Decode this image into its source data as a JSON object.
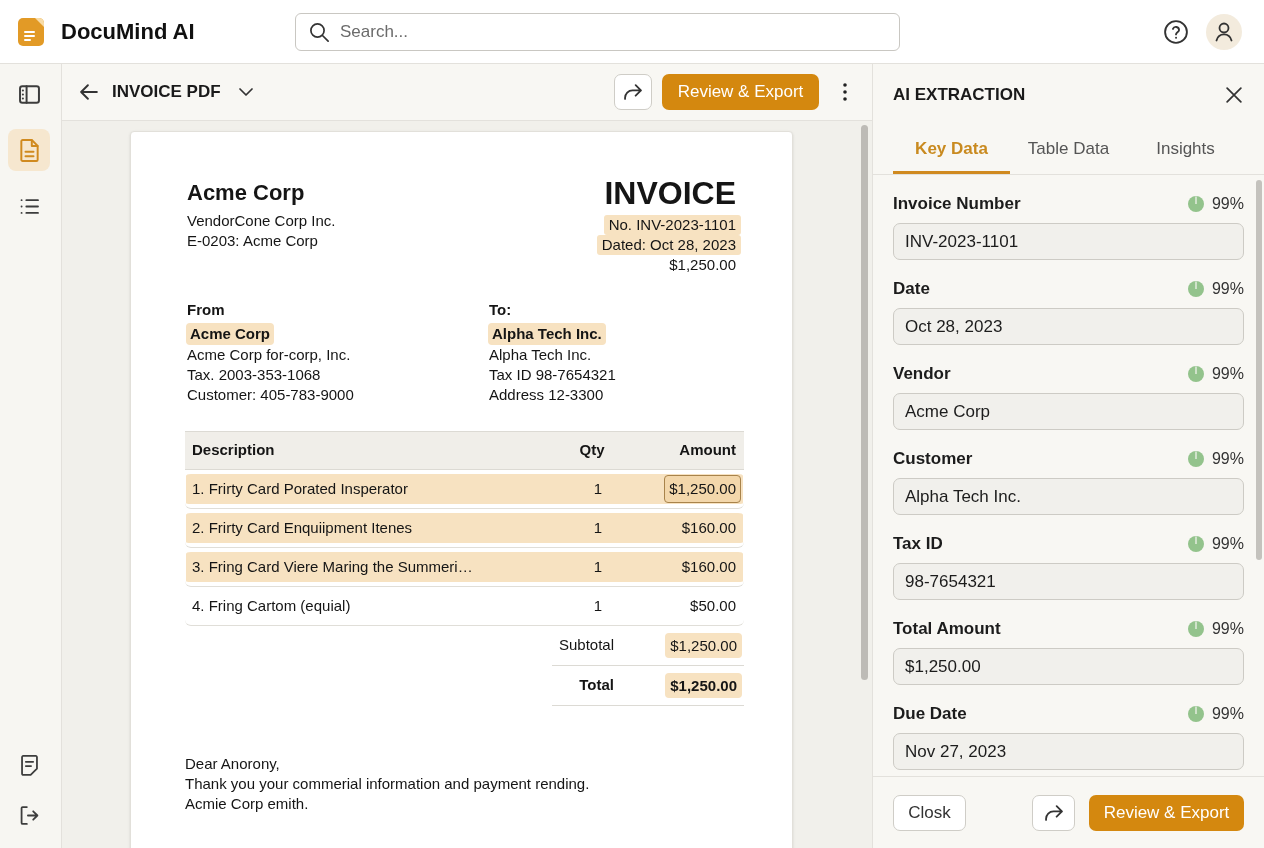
{
  "app": {
    "name": "DocuMind AI"
  },
  "search": {
    "placeholder": "Search..."
  },
  "rail": {
    "items": [
      {
        "kind": "panel",
        "selected": false
      },
      {
        "kind": "document",
        "selected": true
      },
      {
        "kind": "list",
        "selected": false
      }
    ]
  },
  "document_bar": {
    "title": "INVOICE PDF",
    "export_button": "Review & Export"
  },
  "invoice": {
    "vendor_name": "Acme Corp",
    "vendor_lines": [
      "VendorCone Corp Inc.",
      "E-0203: Acme Corp"
    ],
    "title": "INVOICE",
    "meta": [
      {
        "text": "No. INV-2023-1101",
        "highlighted": true
      },
      {
        "text": "Dated: Oct 28, 2023",
        "highlighted": true
      },
      {
        "text": "$1,250.00",
        "highlighted": false
      }
    ],
    "parties": [
      {
        "heading": "From",
        "name": "Acme Corp",
        "name_highlighted": true,
        "lines": [
          "Acme Corp for-corp, Inc.",
          "Tax. 2003-353-1068",
          "Customer: 405-783-9000"
        ]
      },
      {
        "heading": "To:",
        "name": "Alpha Tech Inc.",
        "name_highlighted": true,
        "lines": [
          "Alpha Tech Inc.",
          "Tax ID 98-7654321",
          "Address 12-3300"
        ]
      }
    ],
    "table": {
      "columns": [
        "Description",
        "Qty",
        "Amount"
      ],
      "rows": [
        {
          "description": "1. Frirty Card Porated Insperator",
          "qty": "1",
          "amount": "$1,250.00",
          "highlighted": true,
          "amount_selected": true
        },
        {
          "description": "2. Frirty Card Enquiipment Itenes",
          "qty": "1",
          "amount": "$160.00",
          "highlighted": true,
          "amount_selected": false
        },
        {
          "description": "3. Fring Card Viere Maring the Summeri…",
          "qty": "1",
          "amount": "$160.00",
          "highlighted": true,
          "amount_selected": false
        },
        {
          "description": "4. Fring Cartom (equial)",
          "qty": "1",
          "amount": "$50.00",
          "highlighted": false,
          "amount_selected": false
        }
      ]
    },
    "totals": [
      {
        "kind": "subtotal",
        "label": "Subtotal",
        "amount": "$1,250.00",
        "highlighted": true
      },
      {
        "kind": "total",
        "label": "Total",
        "amount": "$1,250.00",
        "highlighted": true
      }
    ],
    "letter": [
      "Dear Anorony,",
      "Thank you your commerial information and payment rending.",
      "Acmie Corp emith."
    ]
  },
  "extraction_panel": {
    "title": "AI EXTRACTION",
    "tabs": [
      {
        "label": "Key Data",
        "selected": true
      },
      {
        "label": "Table Data",
        "selected": false
      },
      {
        "label": "Insights",
        "selected": false
      }
    ],
    "fields": [
      {
        "label": "Invoice Number",
        "confidence": "99%",
        "value": "INV-2023-1101"
      },
      {
        "label": "Date",
        "confidence": "99%",
        "value": "Oct 28, 2023"
      },
      {
        "label": "Vendor",
        "confidence": "99%",
        "value": "Acme Corp"
      },
      {
        "label": "Customer",
        "confidence": "99%",
        "value": "Alpha Tech Inc."
      },
      {
        "label": "Tax ID",
        "confidence": "99%",
        "value": "98-7654321"
      },
      {
        "label": "Total Amount",
        "confidence": "99%",
        "value": "$1,250.00"
      },
      {
        "label": "Due Date",
        "confidence": "99%",
        "value": "Nov 27, 2023"
      }
    ],
    "footer": {
      "close_button": "Closk",
      "export_button": "Review & Export"
    }
  }
}
